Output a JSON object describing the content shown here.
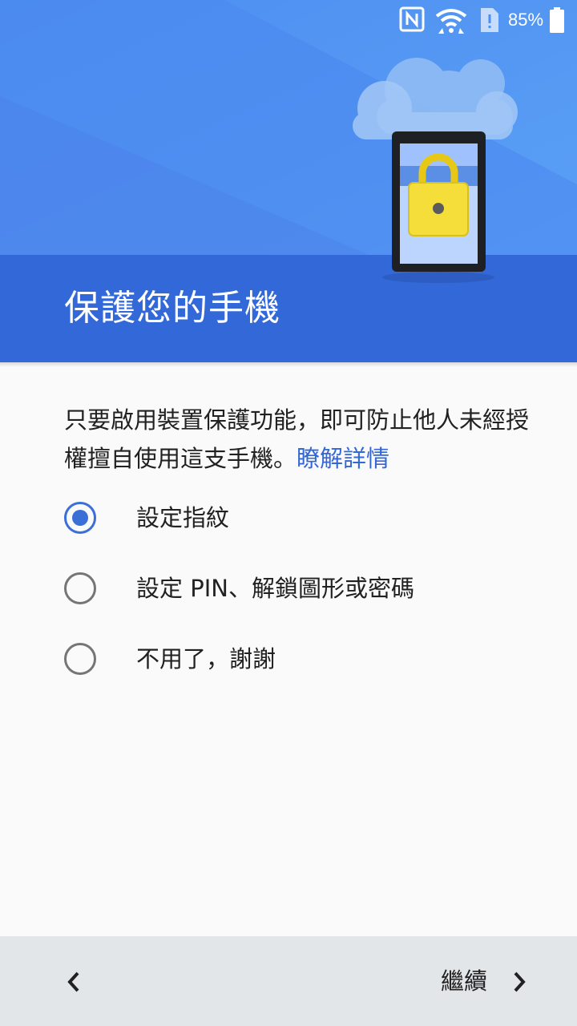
{
  "status_bar": {
    "battery_percent": "85%",
    "icons": [
      "nfc-icon",
      "wifi-icon",
      "sim-alert-icon",
      "battery-icon"
    ]
  },
  "header": {
    "title": "保護您的手機"
  },
  "description": {
    "text": "只要啟用裝置保護功能，即可防止他人未經授權擅自使用這支手機。",
    "link_label": "瞭解詳情"
  },
  "options": [
    {
      "label": "設定指紋",
      "checked": true
    },
    {
      "label": "設定 PIN、解鎖圖形或密碼",
      "checked": false
    },
    {
      "label": "不用了，謝謝",
      "checked": false
    }
  ],
  "footer": {
    "next_label": "繼續"
  },
  "colors": {
    "header_sky": "#4a8ff2",
    "header_band": "#3268d8",
    "accent": "#3367d6",
    "footer_bg": "#e3e6e9"
  }
}
